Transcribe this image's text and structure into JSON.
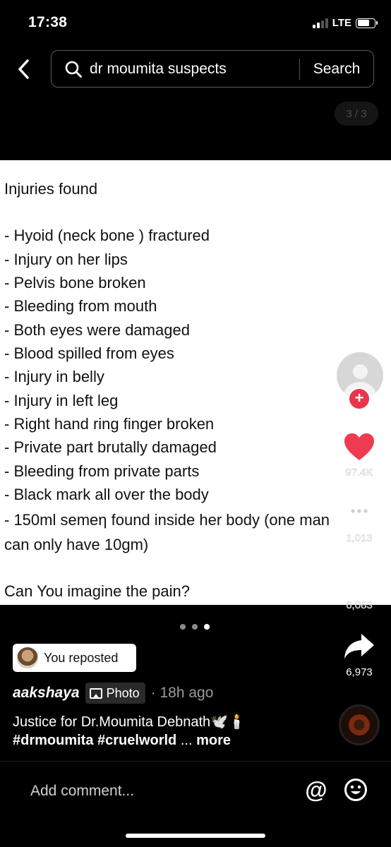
{
  "status_bar": {
    "time": "17:38",
    "network": "LTE",
    "battery_level": 0.7
  },
  "search": {
    "query": "dr moumita suspects",
    "button_label": "Search"
  },
  "page_counter": "3 / 3",
  "slide": {
    "lines": [
      "Injuries found",
      "- Hyoid (neck bone ) fractured",
      "- Injury on her lips",
      "- Pelvis bone broken",
      "- Bleeding from mouth",
      "- Both eyes were damaged",
      "- Blood spilled from eyes",
      "- Injury in belly",
      "- Injury in left leg",
      "- Right hand ring finger broken",
      "- Private part brutally damaged",
      "- Bleeding from private parts",
      "- Black mark all over the body",
      "- 150ml semeη found inside her body (one man",
      "can only have 10gm)",
      "Can You imagine the pain?"
    ]
  },
  "carousel": {
    "total": 3,
    "active_index": 2
  },
  "actions": {
    "likes": "97.4K",
    "comments": "1,013",
    "saves": "6,083",
    "shares": "6,973",
    "like_color": "#ee3b52",
    "follow_color": "#e8354c"
  },
  "post": {
    "repost_label": "You reposted",
    "author": "aakshaya",
    "type_badge": "Photo",
    "time": "· 18h ago",
    "caption_text": "Justice for Dr.Moumita Debnath🕊️🕯️",
    "hashtags": "#drmoumita #cruelworld",
    "ellipsis": " ... ",
    "more": "more"
  },
  "comment_bar": {
    "placeholder": "Add comment..."
  },
  "icons": {
    "back": "chevron-left-icon",
    "search": "search-icon",
    "like": "heart-icon",
    "comment": "comment-bubble-icon",
    "save": "bookmark-icon",
    "share": "share-arrow-icon",
    "mention": "at-icon",
    "emoji": "smiley-icon"
  }
}
